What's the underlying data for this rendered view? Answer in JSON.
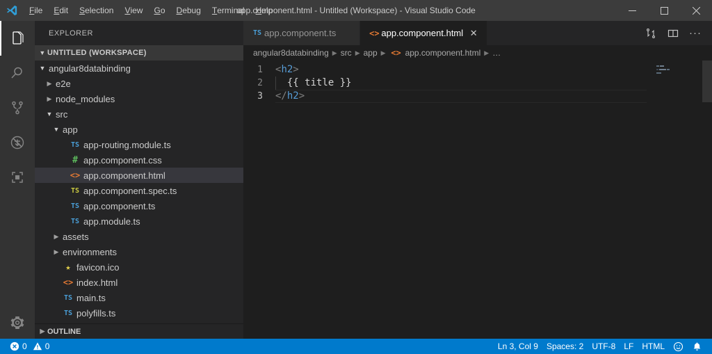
{
  "window": {
    "title": "app.component.html - Untitled (Workspace) - Visual Studio Code",
    "controls": {
      "minimize": "minimize-icon",
      "maximize": "maximize-icon",
      "close": "close-icon"
    }
  },
  "menubar": {
    "items": [
      {
        "label": "File",
        "mnemonic": "F"
      },
      {
        "label": "Edit",
        "mnemonic": "E"
      },
      {
        "label": "Selection",
        "mnemonic": "S"
      },
      {
        "label": "View",
        "mnemonic": "V"
      },
      {
        "label": "Go",
        "mnemonic": "G"
      },
      {
        "label": "Debug",
        "mnemonic": "D"
      },
      {
        "label": "Terminal",
        "mnemonic": "T"
      },
      {
        "label": "Help",
        "mnemonic": "H"
      }
    ]
  },
  "activitybar": {
    "items": [
      {
        "name": "explorer-icon",
        "title": "Explorer",
        "active": true
      },
      {
        "name": "search-icon",
        "title": "Search",
        "active": false
      },
      {
        "name": "source-control-icon",
        "title": "Source Control",
        "active": false
      },
      {
        "name": "run-debug-icon",
        "title": "Run and Debug",
        "active": false
      },
      {
        "name": "extensions-icon",
        "title": "Extensions",
        "active": false
      }
    ],
    "bottom": {
      "name": "settings-gear-icon",
      "title": "Manage"
    }
  },
  "sidebar": {
    "title": "EXPLORER",
    "workspace_header": "UNTITLED (WORKSPACE)",
    "outline_header": "OUTLINE",
    "tree": [
      {
        "label": "angular8databinding",
        "type": "folder",
        "state": "expanded",
        "indent": 1
      },
      {
        "label": "e2e",
        "type": "folder",
        "state": "collapsed",
        "indent": 2
      },
      {
        "label": "node_modules",
        "type": "folder",
        "state": "collapsed",
        "indent": 2
      },
      {
        "label": "src",
        "type": "folder",
        "state": "expanded",
        "indent": 2
      },
      {
        "label": "app",
        "type": "folder",
        "state": "expanded",
        "indent": 3
      },
      {
        "label": "app-routing.module.ts",
        "type": "file",
        "icon": "ts",
        "indent": 4
      },
      {
        "label": "app.component.css",
        "type": "file",
        "icon": "css",
        "indent": 4
      },
      {
        "label": "app.component.html",
        "type": "file",
        "icon": "html",
        "indent": 4,
        "selected": true
      },
      {
        "label": "app.component.spec.ts",
        "type": "file",
        "icon": "ts-yellow",
        "indent": 4
      },
      {
        "label": "app.component.ts",
        "type": "file",
        "icon": "ts",
        "indent": 4
      },
      {
        "label": "app.module.ts",
        "type": "file",
        "icon": "ts",
        "indent": 4
      },
      {
        "label": "assets",
        "type": "folder",
        "state": "collapsed",
        "indent": 3
      },
      {
        "label": "environments",
        "type": "folder",
        "state": "collapsed",
        "indent": 3
      },
      {
        "label": "favicon.ico",
        "type": "file",
        "icon": "star",
        "indent": 3
      },
      {
        "label": "index.html",
        "type": "file",
        "icon": "html",
        "indent": 3
      },
      {
        "label": "main.ts",
        "type": "file",
        "icon": "ts",
        "indent": 3
      },
      {
        "label": "polyfills.ts",
        "type": "file",
        "icon": "ts",
        "indent": 3
      }
    ]
  },
  "editor": {
    "tabs": [
      {
        "label": "app.component.ts",
        "icon": "ts",
        "active": false
      },
      {
        "label": "app.component.html",
        "icon": "html",
        "active": true,
        "close": "×"
      }
    ],
    "actions": [
      {
        "name": "split-diff-icon",
        "title": "Compare"
      },
      {
        "name": "split-editor-icon",
        "title": "Split Editor"
      },
      {
        "name": "more-actions-icon",
        "title": "More Actions...",
        "glyph": "···"
      }
    ],
    "breadcrumbs": [
      {
        "label": "angular8databinding",
        "icon": ""
      },
      {
        "label": "src",
        "icon": ""
      },
      {
        "label": "app",
        "icon": ""
      },
      {
        "label": "app.component.html",
        "icon": "html"
      },
      {
        "label": "…",
        "icon": ""
      }
    ],
    "separator": "❯",
    "lines": [
      {
        "number": "1",
        "tokens": [
          {
            "text": "<",
            "type": "bracket"
          },
          {
            "text": "h2",
            "type": "tag"
          },
          {
            "text": ">",
            "type": "bracket"
          }
        ]
      },
      {
        "number": "2",
        "indent_guide": true,
        "tokens": [
          {
            "text": "  {{ title }}",
            "type": "text"
          }
        ]
      },
      {
        "number": "3",
        "current": true,
        "tokens": [
          {
            "text": "</",
            "type": "bracket"
          },
          {
            "text": "h2",
            "type": "tag"
          },
          {
            "text": ">",
            "type": "bracket"
          }
        ]
      }
    ]
  },
  "statusbar": {
    "errors": {
      "icon": "error-icon",
      "count": "0"
    },
    "warnings": {
      "icon": "warning-icon",
      "count": "0"
    },
    "cursor": "Ln 3, Col 9",
    "indentation": "Spaces: 2",
    "encoding": "UTF-8",
    "eol": "LF",
    "language": "HTML",
    "feedback": "feedback-smiley-icon",
    "notifications": "bell-icon"
  },
  "colors": {
    "accent": "#007acc",
    "titlebar": "#3c3c3c",
    "sidebar": "#252526",
    "activitybar": "#333333",
    "editor": "#1e1e1e",
    "tag": "#569cd6",
    "bracket": "#808080",
    "html_icon": "#e37933",
    "ts_icon": "#4a9fd8",
    "css_icon": "#5cb85c"
  }
}
